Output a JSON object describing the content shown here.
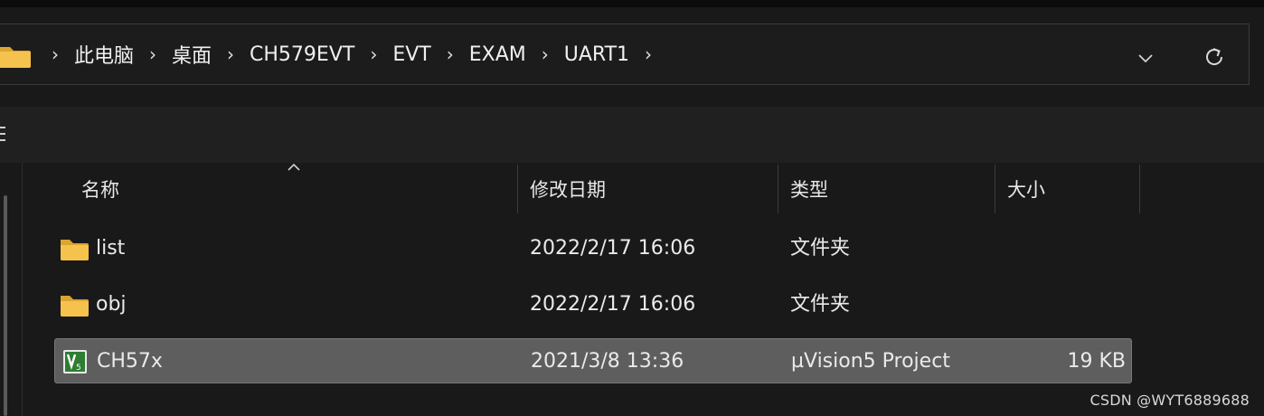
{
  "address_bar": {
    "breadcrumbs": [
      "此电脑",
      "桌面",
      "CH579EVT",
      "EVT",
      "EXAM",
      "UART1"
    ],
    "separator": "›"
  },
  "columns": {
    "name": "名称",
    "modified": "修改日期",
    "type": "类型",
    "size": "大小"
  },
  "files": [
    {
      "name": "list",
      "modified": "2022/2/17 16:06",
      "type": "文件夹",
      "size": "",
      "icon": "folder-icon"
    },
    {
      "name": "obj",
      "modified": "2022/2/17 16:06",
      "type": "文件夹",
      "size": "",
      "icon": "folder-icon"
    },
    {
      "name": "CH57x",
      "modified": "2021/3/8 13:36",
      "type": "µVision5 Project",
      "size": "19 KB",
      "icon": "uvision-project-icon",
      "selected": true
    }
  ],
  "watermark": "CSDN @WYT6889688",
  "colors": {
    "folder": "#f4c24d",
    "folder_dark": "#dca531",
    "selected_row": "#5e5e5e",
    "uvision_green": "#2e7d32"
  }
}
